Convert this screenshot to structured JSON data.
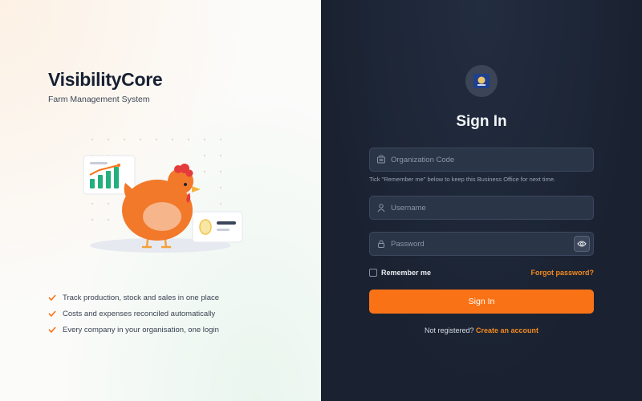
{
  "brand": {
    "name": "VisibilityCore",
    "subtitle": "Farm Management System"
  },
  "features": [
    "Track production, stock and sales in one place",
    "Costs and expenses reconciled automatically",
    "Every company in your organisation, one login"
  ],
  "form": {
    "title": "Sign In",
    "org_placeholder": "Organization Code",
    "org_hint": "Tick \"Remember me\" below to keep this Business Office for next time.",
    "username_placeholder": "Username",
    "password_placeholder": "Password",
    "remember_label": "Remember me",
    "forgot_label": "Forgot password?",
    "submit_label": "Sign In",
    "register_prompt": "Not registered?",
    "register_link": "Create an account"
  },
  "colors": {
    "accent": "#f97316",
    "panel_dark": "#1b2333",
    "field_bg": "#2b3548",
    "check_green": "#f97316"
  },
  "icons": {
    "org": "building-icon",
    "user": "user-icon",
    "password": "lock-icon",
    "toggle": "eye-icon",
    "feature": "check-icon"
  }
}
